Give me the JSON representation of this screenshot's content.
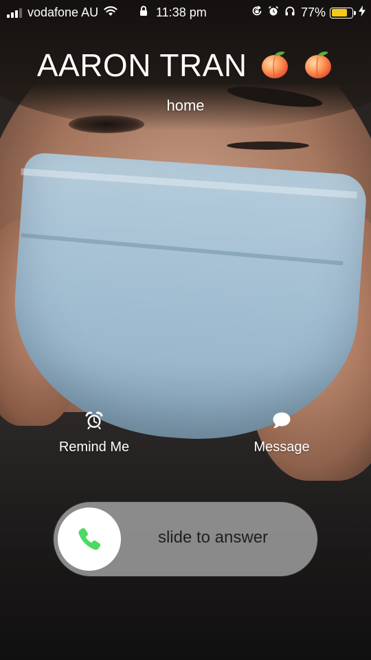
{
  "status_bar": {
    "carrier": "vodafone AU",
    "time": "11:38 pm",
    "battery_percent": "77%",
    "battery_level": 0.77,
    "battery_color": "#f6c913",
    "signal_bars_filled": 3,
    "signal_bars_total": 4,
    "icons": [
      "signal-icon",
      "wifi-icon",
      "lock-icon",
      "orientation-lock-icon",
      "alarm-icon",
      "headphones-icon",
      "battery-icon",
      "charging-bolt-icon"
    ]
  },
  "caller": {
    "name": "AARON TRAN",
    "emoji_icons": [
      "peach-icon",
      "peach-icon"
    ],
    "label": "home"
  },
  "actions": {
    "remind": {
      "label": "Remind Me",
      "icon": "alarm-clock-icon"
    },
    "message": {
      "label": "Message",
      "icon": "speech-bubble-icon"
    }
  },
  "slider": {
    "text": "slide to answer",
    "knob_icon": "phone-icon",
    "accent_color": "#4cd964"
  }
}
